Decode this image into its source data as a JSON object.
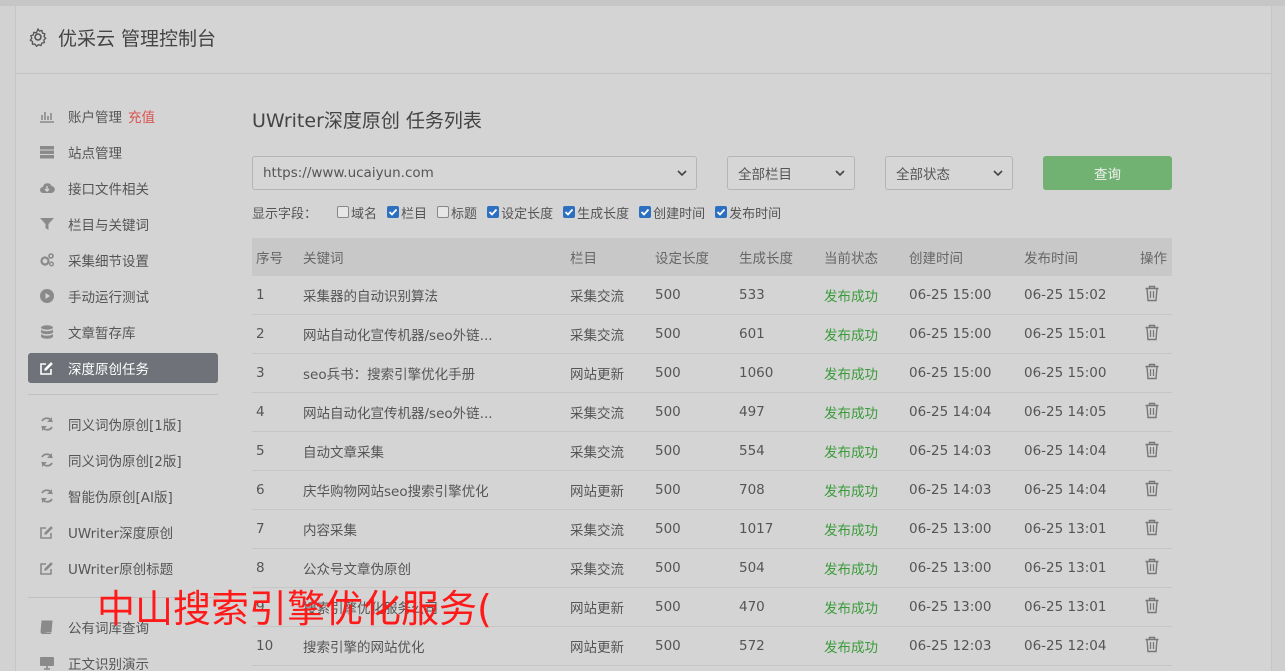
{
  "app": {
    "title": "优采云 管理控制台"
  },
  "sidebar": {
    "groups": [
      [
        {
          "label": "账户管理",
          "badge": "充值",
          "icon": "bar-chart-icon"
        },
        {
          "label": "站点管理",
          "icon": "server-icon"
        },
        {
          "label": "接口文件相关",
          "icon": "cloud-download-icon"
        },
        {
          "label": "栏目与关键词",
          "icon": "filter-icon"
        },
        {
          "label": "采集细节设置",
          "icon": "gears-icon"
        },
        {
          "label": "手动运行测试",
          "icon": "play-circle-icon"
        },
        {
          "label": "文章暂存库",
          "icon": "database-icon"
        },
        {
          "label": "深度原创任务",
          "icon": "edit-icon",
          "active": true
        }
      ],
      [
        {
          "label": "同义词伪原创[1版]",
          "icon": "refresh-icon"
        },
        {
          "label": "同义词伪原创[2版]",
          "icon": "refresh-icon"
        },
        {
          "label": "智能伪原创[AI版]",
          "icon": "refresh-icon"
        },
        {
          "label": "UWriter深度原创",
          "icon": "edit-icon"
        },
        {
          "label": "UWriter原创标题",
          "icon": "edit-icon"
        }
      ],
      [
        {
          "label": "公有词库查询",
          "icon": "book-icon"
        },
        {
          "label": "正文识别演示",
          "icon": "monitor-icon"
        }
      ]
    ]
  },
  "main": {
    "title": "UWriter深度原创 任务列表",
    "filters": {
      "site": "https://www.ucaiyun.com",
      "column": "全部栏目",
      "status": "全部状态",
      "query_label": "查询"
    },
    "fields_label": "显示字段：",
    "fields": [
      {
        "label": "域名",
        "checked": false
      },
      {
        "label": "栏目",
        "checked": true
      },
      {
        "label": "标题",
        "checked": false
      },
      {
        "label": "设定长度",
        "checked": true
      },
      {
        "label": "生成长度",
        "checked": true
      },
      {
        "label": "创建时间",
        "checked": true
      },
      {
        "label": "发布时间",
        "checked": true
      }
    ],
    "table": {
      "headers": [
        "序号",
        "关键词",
        "栏目",
        "设定长度",
        "生成长度",
        "当前状态",
        "创建时间",
        "发布时间",
        "操作"
      ],
      "rows": [
        [
          "1",
          "采集器的自动识别算法",
          "采集交流",
          "500",
          "533",
          "发布成功",
          "06-25 15:00",
          "06-25 15:02"
        ],
        [
          "2",
          "网站自动化宣传机器/seo外链...",
          "采集交流",
          "500",
          "601",
          "发布成功",
          "06-25 15:00",
          "06-25 15:01"
        ],
        [
          "3",
          "seo兵书：搜索引擎优化手册",
          "网站更新",
          "500",
          "1060",
          "发布成功",
          "06-25 15:00",
          "06-25 15:00"
        ],
        [
          "4",
          "网站自动化宣传机器/seo外链...",
          "采集交流",
          "500",
          "497",
          "发布成功",
          "06-25 14:04",
          "06-25 14:05"
        ],
        [
          "5",
          "自动文章采集",
          "采集交流",
          "500",
          "554",
          "发布成功",
          "06-25 14:03",
          "06-25 14:04"
        ],
        [
          "6",
          "庆华购物网站seo搜索引擎优化",
          "网站更新",
          "500",
          "708",
          "发布成功",
          "06-25 14:03",
          "06-25 14:04"
        ],
        [
          "7",
          "内容采集",
          "采集交流",
          "500",
          "1017",
          "发布成功",
          "06-25 13:00",
          "06-25 13:01"
        ],
        [
          "8",
          "公众号文章伪原创",
          "采集交流",
          "500",
          "504",
          "发布成功",
          "06-25 13:00",
          "06-25 13:01"
        ],
        [
          "9",
          "搜索引擎优化服务公司",
          "网站更新",
          "500",
          "470",
          "发布成功",
          "06-25 13:00",
          "06-25 13:01"
        ],
        [
          "10",
          "搜索引擎的网站优化",
          "网站更新",
          "500",
          "572",
          "发布成功",
          "06-25 12:03",
          "06-25 12:04"
        ]
      ]
    }
  },
  "watermark": "中山搜索引擎优化服务(",
  "colors": {
    "success": "#3a9b3a",
    "query_button": "#71b272",
    "badge": "#d9534f",
    "active_nav": "#6f7278",
    "checkbox": "#2d6fc1"
  }
}
